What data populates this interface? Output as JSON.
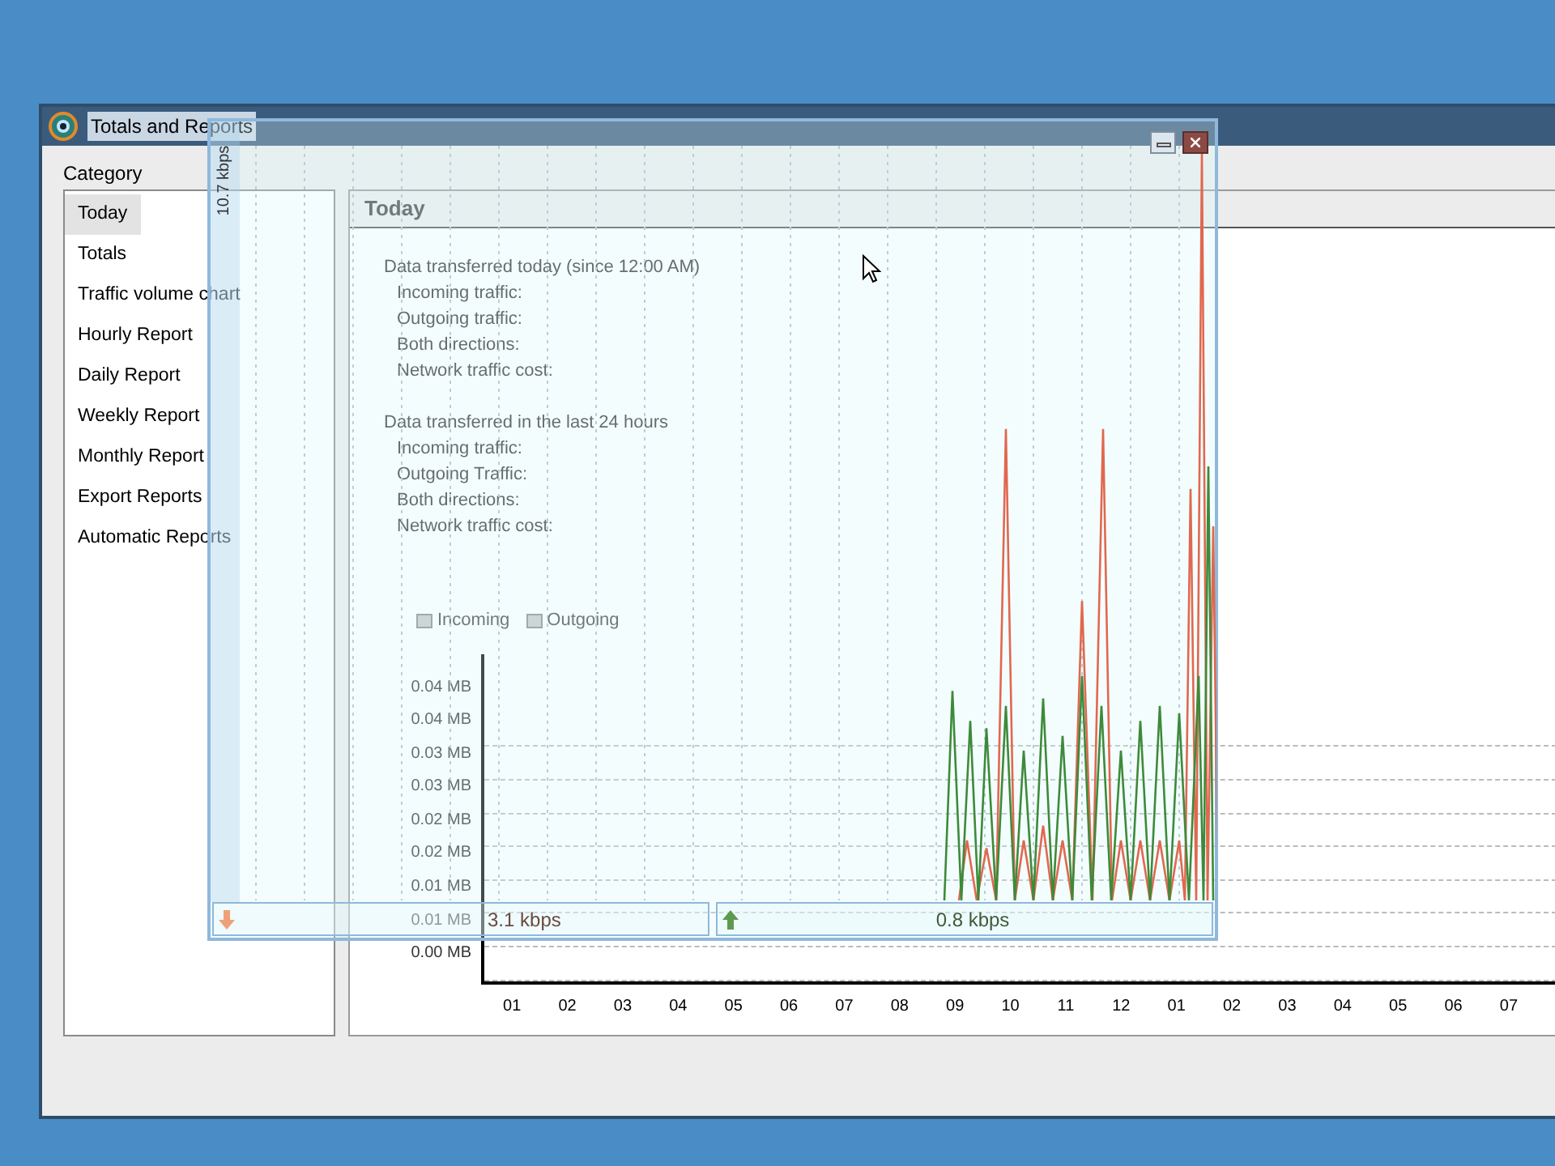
{
  "window": {
    "title": "Totals and Reports"
  },
  "sidebar": {
    "label": "Category",
    "items": [
      {
        "label": "Today",
        "selected": true
      },
      {
        "label": "Totals",
        "selected": false
      },
      {
        "label": "Traffic volume chart",
        "selected": false
      },
      {
        "label": "Hourly Report",
        "selected": false
      },
      {
        "label": "Daily Report",
        "selected": false
      },
      {
        "label": "Weekly Report",
        "selected": false
      },
      {
        "label": "Monthly Report",
        "selected": false
      },
      {
        "label": "Export Reports",
        "selected": false
      },
      {
        "label": "Automatic Reports",
        "selected": false
      }
    ]
  },
  "report": {
    "heading": "Today",
    "sections": [
      {
        "title": "Data transferred today (since 12:00 AM)",
        "rows": [
          "Incoming traffic:",
          "Outgoing traffic:",
          "Both directions:",
          "Network traffic cost:"
        ]
      },
      {
        "title": "Data transferred in the last 24 hours",
        "rows": [
          "Incoming traffic:",
          "Outgoing Traffic:",
          "Both directions:",
          "Network traffic cost:"
        ]
      }
    ],
    "chart": {
      "legend": [
        "Incoming",
        "Outgoing"
      ],
      "y_labels": [
        "0.04 MB",
        "0.04 MB",
        "0.03 MB",
        "0.03 MB",
        "0.02 MB",
        "0.02 MB",
        "0.01 MB",
        "0.01 MB",
        "0.00 MB"
      ],
      "x_labels": [
        "01",
        "02",
        "03",
        "04",
        "05",
        "06",
        "07",
        "08",
        "09",
        "10",
        "11",
        "12",
        "01",
        "02",
        "03",
        "04",
        "05",
        "06",
        "07"
      ]
    }
  },
  "meter": {
    "scale_label": "10.7 kbps",
    "download": "3.1 kbps",
    "upload": "0.8 kbps"
  }
}
